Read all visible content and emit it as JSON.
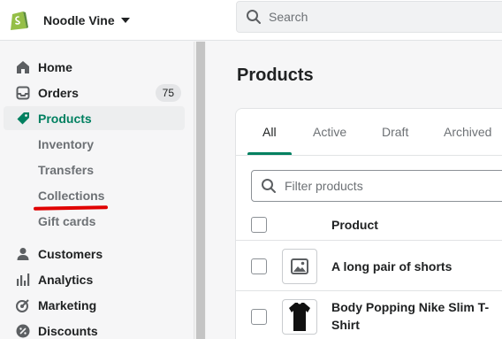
{
  "header": {
    "store_name": "Noodle Vine",
    "search_placeholder": "Search"
  },
  "sidebar": {
    "items": [
      {
        "label": "Home",
        "icon": "home-icon"
      },
      {
        "label": "Orders",
        "icon": "orders-icon",
        "badge": "75"
      },
      {
        "label": "Products",
        "icon": "tag-icon",
        "active": true
      },
      {
        "label": "Inventory"
      },
      {
        "label": "Transfers"
      },
      {
        "label": "Collections"
      },
      {
        "label": "Gift cards"
      },
      {
        "label": "Customers",
        "icon": "person-icon"
      },
      {
        "label": "Analytics",
        "icon": "bar-chart-icon"
      },
      {
        "label": "Marketing",
        "icon": "target-icon"
      },
      {
        "label": "Discounts",
        "icon": "discount-icon"
      }
    ]
  },
  "main": {
    "title": "Products",
    "tabs": [
      "All",
      "Active",
      "Draft",
      "Archived"
    ],
    "filter_placeholder": "Filter products",
    "column_product": "Product",
    "products": [
      {
        "name": "A long pair of shorts",
        "thumb": "image-placeholder-icon"
      },
      {
        "name": "Body Popping Nike Slim T-Shirt",
        "thumb": "black-tshirt-image"
      }
    ]
  },
  "colors": {
    "accent": "#008060",
    "annotation": "#e00000"
  }
}
